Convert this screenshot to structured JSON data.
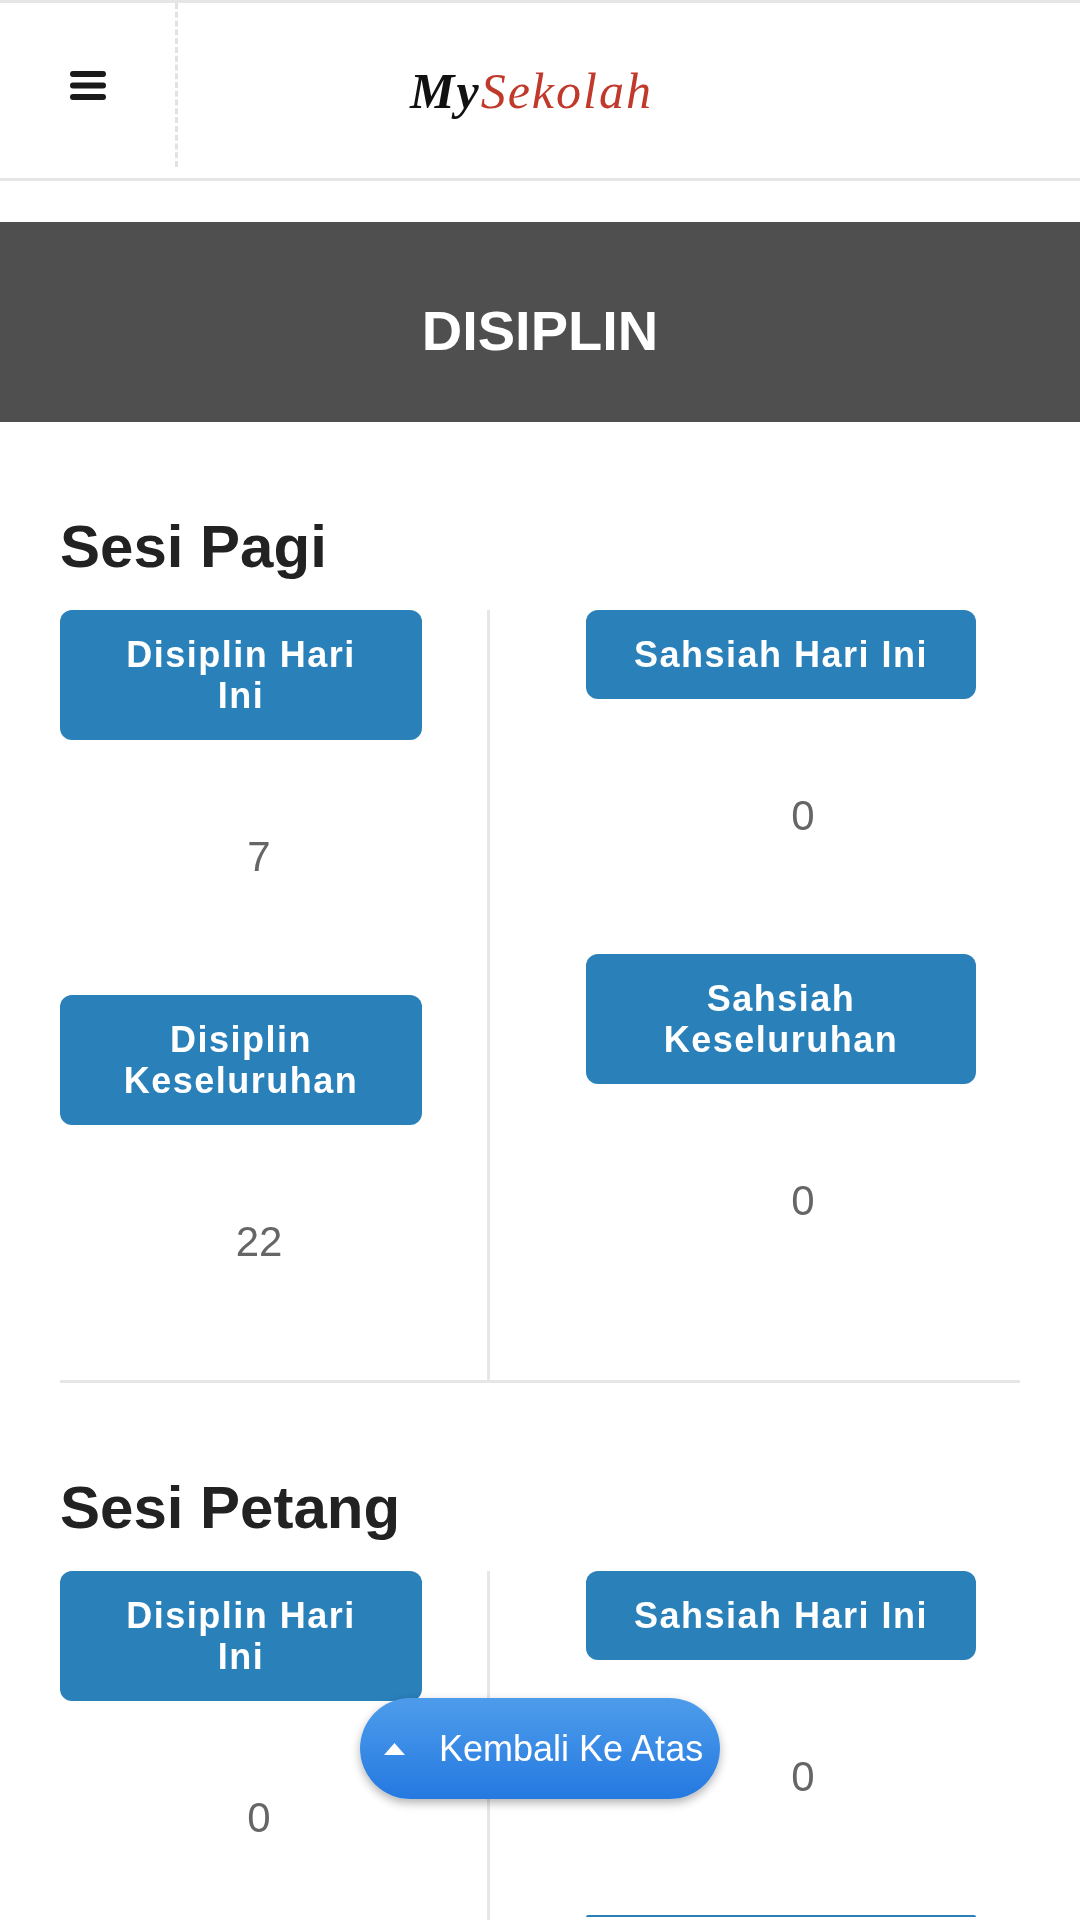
{
  "header": {
    "logo": {
      "prefix": "My",
      "suffix": "Sekolah"
    }
  },
  "banner": {
    "title": "DISIPLIN"
  },
  "sections": [
    {
      "title": "Sesi Pagi",
      "columns": [
        {
          "items": [
            {
              "kind": "stat",
              "label": "Disiplin Hari Ini",
              "value": "7"
            },
            {
              "kind": "stat",
              "label": "Disiplin Keseluruhan",
              "value": "22"
            }
          ]
        },
        {
          "items": [
            {
              "kind": "stat",
              "label": "Sahsiah Hari Ini",
              "value": "0"
            },
            {
              "kind": "stat",
              "label": "Sahsiah Keseluruhan",
              "value": "0"
            }
          ]
        }
      ]
    },
    {
      "title": "Sesi Petang",
      "columns": [
        {
          "items": [
            {
              "kind": "stat",
              "label": "Disiplin Hari Ini",
              "value": "0"
            }
          ]
        },
        {
          "items": [
            {
              "kind": "stat",
              "label": "Sahsiah Hari Ini",
              "value": "0"
            },
            {
              "kind": "cut_off"
            }
          ]
        }
      ]
    }
  ],
  "back_to_top": {
    "label": "Kembali Ke Atas"
  }
}
